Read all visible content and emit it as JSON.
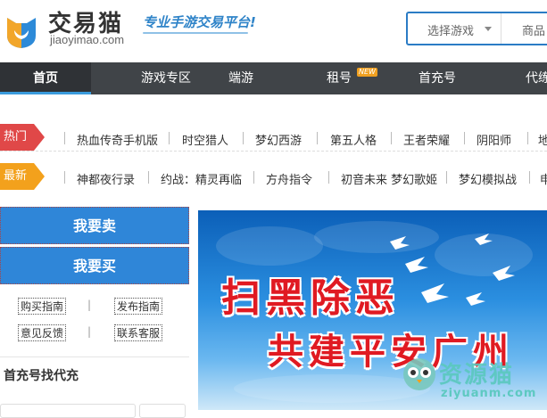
{
  "header": {
    "brand": "交易猫",
    "domain": "jiaoyimao.com",
    "slogan": "专业手游交易平台!",
    "search": {
      "game_select": "选择游戏",
      "goods": "商品"
    }
  },
  "nav": {
    "items": [
      {
        "label": "首页"
      },
      {
        "label": "游戏专区"
      },
      {
        "label": "端游"
      },
      {
        "label": "租号",
        "badge": "NEW"
      },
      {
        "label": "首充号"
      },
      {
        "label": "代练"
      }
    ]
  },
  "tags": {
    "hot": {
      "label": "热门",
      "games": [
        "热血传奇手机版",
        "时空猎人",
        "梦幻西游",
        "第五人格",
        "王者荣耀",
        "阴阳师",
        "地"
      ]
    },
    "latest": {
      "label": "最新",
      "games": [
        "神都夜行录",
        "约战：精灵再临",
        "方舟指令",
        "初音未来 梦幻歌姬",
        "梦幻模拟战",
        "申"
      ]
    }
  },
  "sidebar": {
    "sell_label": "我要卖",
    "buy_label": "我要买",
    "links": [
      "购买指南",
      "发布指南",
      "意见反馈",
      "联系客服"
    ],
    "sep": "|",
    "panel_title": "首充号找代充"
  },
  "banner": {
    "line1": "扫黑除恶",
    "line2": "共建平安广州",
    "watermark_text": "资源猫",
    "watermark_url": "ziyuanm.com"
  },
  "colors": {
    "accent": "#2f86d8",
    "nav_bg": "#404448",
    "hot": "#e04848",
    "new": "#f3a11c",
    "banner_red": "#e01a22"
  }
}
